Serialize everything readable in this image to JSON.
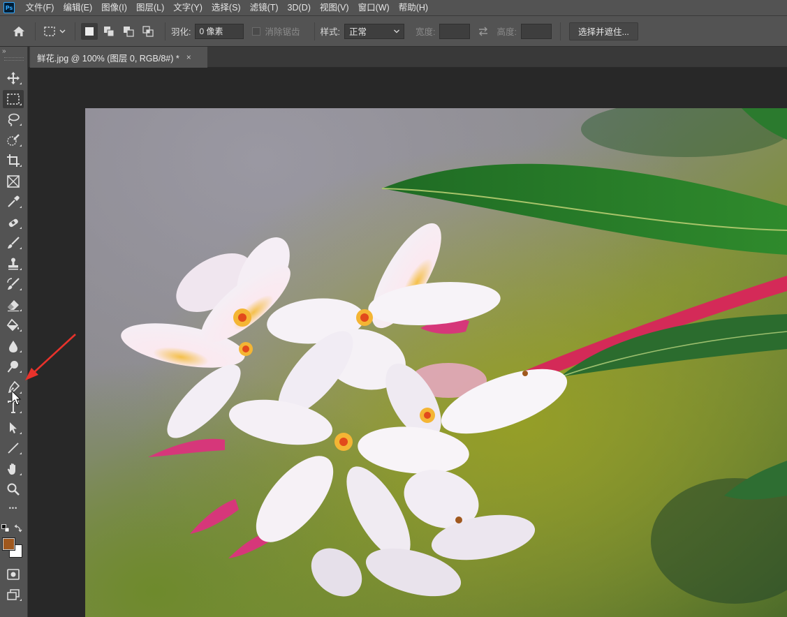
{
  "app": {
    "logo_text": "Ps"
  },
  "menu": {
    "items": [
      "文件(F)",
      "编辑(E)",
      "图像(I)",
      "图层(L)",
      "文字(Y)",
      "选择(S)",
      "滤镜(T)",
      "3D(D)",
      "视图(V)",
      "窗口(W)",
      "帮助(H)"
    ]
  },
  "options": {
    "feather_label": "羽化:",
    "feather_value": "0 像素",
    "antialias_label": "消除锯齿",
    "style_label": "样式:",
    "style_value": "正常",
    "width_label": "宽度:",
    "height_label": "高度:",
    "select_mask_label": "选择并遮住..."
  },
  "panel": {
    "collapse_glyph": "»"
  },
  "document": {
    "tab_title": "鲜花.jpg @ 100% (图层 0, RGB/8#) *",
    "close_glyph": "×"
  },
  "tools": {
    "active": "rectangular-marquee-tool",
    "hovered": "pen-tool",
    "more_glyph": "•••"
  },
  "colors": {
    "foreground": "#a0581e",
    "background": "#ffffff",
    "annotation_arrow": "#e8322b",
    "ui_panel": "#535353",
    "workspace": "#282828"
  }
}
